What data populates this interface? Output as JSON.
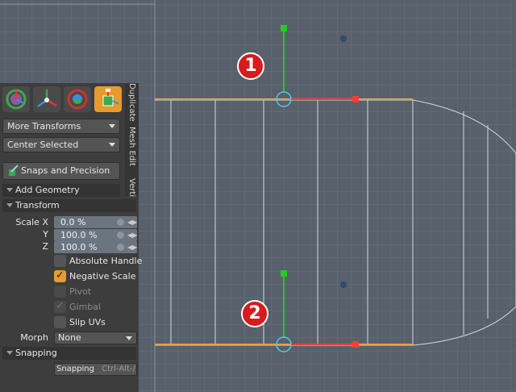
{
  "side_tabs": [
    "Duplicate",
    "Mesh Edit",
    "Verti"
  ],
  "tool_icons": [
    "move-tool-icon",
    "rotate-tool-icon",
    "transform-tool-icon",
    "scale-tool-icon"
  ],
  "dropdowns": {
    "more_transforms": "More Transforms",
    "center_selected": "Center Selected"
  },
  "snaps_button": "Snaps and Precision",
  "sections": {
    "add_geometry": "Add Geometry",
    "transform": "Transform",
    "snapping": "Snapping"
  },
  "scale": {
    "x_label": "Scale X",
    "y_label": "Y",
    "z_label": "Z",
    "x_value": "0.0 %",
    "y_value": "100.0 %",
    "z_value": "100.0 %"
  },
  "options": {
    "absolute_handle": "Absolute Handle",
    "negative_scale": "Negative Scale",
    "pivot": "Pivot",
    "gimbal": "Gimbal",
    "slip_uvs": "Slip UVs"
  },
  "morph": {
    "label": "Morph",
    "value": "None"
  },
  "snapping_button": {
    "label": "Snapping",
    "shortcut": "Ctrl-Alt-/"
  },
  "annotations": [
    "1",
    "2"
  ],
  "colors": {
    "accent": "#e59b2e",
    "badge": "#d61c1c",
    "handle_green": "#22cc22",
    "edge": "#e8a040",
    "viewport": "#58606b"
  }
}
